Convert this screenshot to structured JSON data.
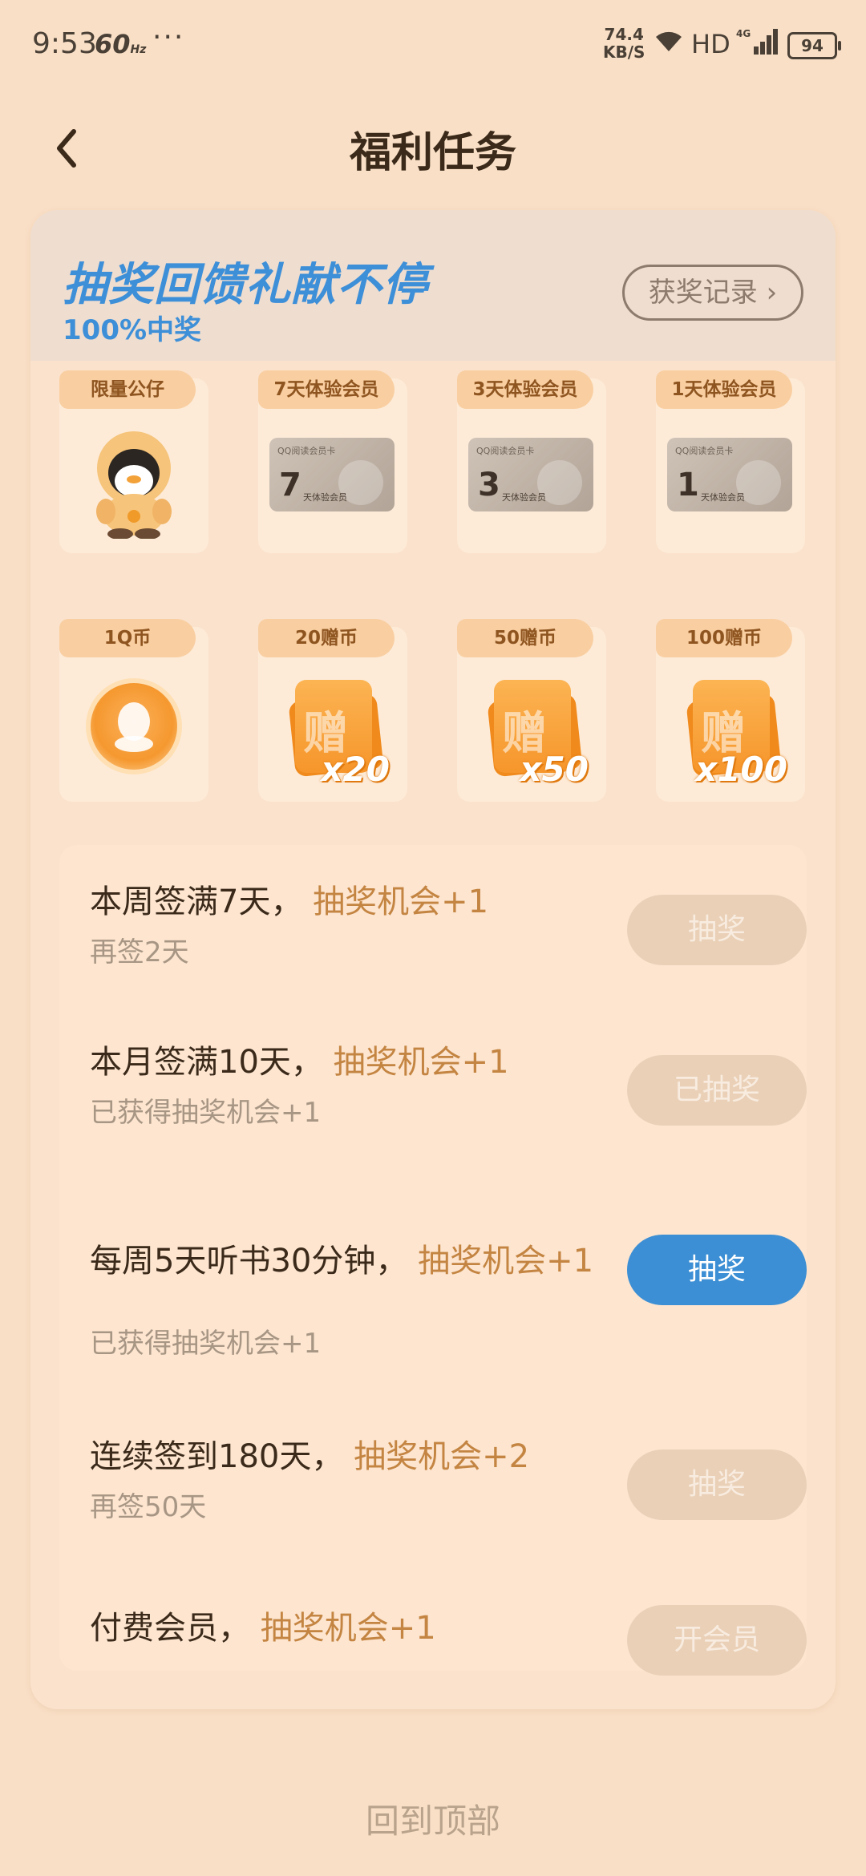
{
  "status_bar": {
    "time": "9:53",
    "refresh_rate": "60",
    "refresh_unit": "Hz",
    "dots": "···",
    "net_speed_value": "74.4",
    "net_speed_unit": "KB/S",
    "hd": "HD",
    "network": "4G",
    "battery": "94"
  },
  "header": {
    "back_icon": "chevron-left-icon",
    "title": "福利任务"
  },
  "lottery": {
    "slogan": "抽奖回馈礼献不停",
    "subtitle": "100%中奖",
    "record_button": "获奖记录 ›",
    "accent_color": "#3d8fd8",
    "prizes": [
      {
        "tag": "限量公仔",
        "kind": "figure",
        "icon": "penguin-figure-icon"
      },
      {
        "tag": "7天体验会员",
        "kind": "vip-card",
        "card_header": "QQ阅读会员卡",
        "days": "7",
        "card_text": "天体验会员"
      },
      {
        "tag": "3天体验会员",
        "kind": "vip-card",
        "card_header": "QQ阅读会员卡",
        "days": "3",
        "card_text": "天体验会员"
      },
      {
        "tag": "1天体验会员",
        "kind": "vip-card",
        "card_header": "QQ阅读会员卡",
        "days": "1",
        "card_text": "天体验会员"
      },
      {
        "tag": "1Q币",
        "kind": "coin",
        "icon": "qq-coin-icon"
      },
      {
        "tag": "20赠币",
        "kind": "gift",
        "char": "赠",
        "amount": "x20"
      },
      {
        "tag": "50赠币",
        "kind": "gift",
        "char": "赠",
        "amount": "x50"
      },
      {
        "tag": "100赠币",
        "kind": "gift",
        "char": "赠",
        "amount": "x100"
      }
    ]
  },
  "tasks": [
    {
      "title": "本周签满7天，",
      "reward": "抽奖机会+1",
      "subtitle": "再签2天",
      "button": "抽奖",
      "enabled": false
    },
    {
      "title": "本月签满10天，",
      "reward": "抽奖机会+1",
      "subtitle": "已获得抽奖机会+1",
      "button": "已抽奖",
      "enabled": false
    },
    {
      "title": "每周5天听书30分钟，",
      "reward": "抽奖机会+1",
      "subtitle": "已获得抽奖机会+1",
      "button": "抽奖",
      "enabled": true
    },
    {
      "title": "连续签到180天，",
      "reward": "抽奖机会+2",
      "subtitle": "再签50天",
      "button": "抽奖",
      "enabled": false
    },
    {
      "title": "付费会员，",
      "reward": "抽奖机会+1",
      "subtitle": "",
      "button": "开会员",
      "enabled": false
    }
  ],
  "footer": {
    "back_to_top": "回到顶部"
  },
  "colors": {
    "background": "#f9dfc6",
    "highlight": "#c48542",
    "active_button": "#3c8fd4",
    "disabled_button": "#ead0b7"
  }
}
